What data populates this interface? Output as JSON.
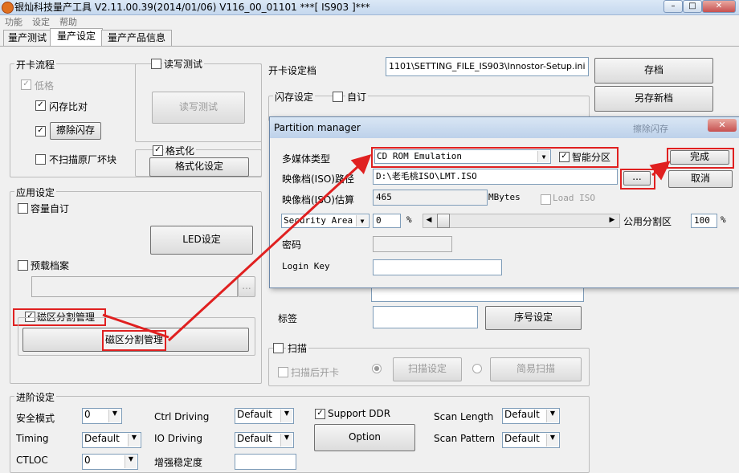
{
  "window": {
    "title": "银灿科技量产工具 V2.11.00.39(2014/01/06)    V116_00_01101                    ***[ IS903 ]***"
  },
  "menu": [
    "功能",
    "设定",
    "帮助"
  ],
  "tabs": [
    "量产测试",
    "量产设定",
    "量产产品信息"
  ],
  "card_flow": {
    "label": "开卡流程",
    "low_format": "低格",
    "flash_compare": "闪存比对",
    "erase_flash": "擦除闪存",
    "no_scan_factory_bad": "不扫描原厂坏块"
  },
  "rw_test": {
    "label": "读写测试",
    "button": "读写测试"
  },
  "format": {
    "label": "格式化",
    "button": "格式化设定"
  },
  "app_settings": {
    "label": "应用设定",
    "capacity_custom": "容量自订",
    "led_button": "LED设定",
    "preload": "预载档案",
    "preload_browse": "...",
    "partition_mgmt": "磁区分割管理",
    "partition_button": "磁区分割管理"
  },
  "open_card_file": {
    "label": "开卡设定档",
    "value": "1101\\SETTING_FILE_IS903\\Innostor-Setup.ini"
  },
  "buttons": {
    "save": "存档",
    "save_as": "另存新档",
    "serial": "序号设定"
  },
  "flash_settings": {
    "label": "闪存设定",
    "custom": "自订"
  },
  "tag": {
    "label": "标签"
  },
  "scan": {
    "label": "扫描",
    "open_after_scan": "扫描后开卡",
    "scan_settings": "扫描设定",
    "simple_scan": "简易扫描"
  },
  "advanced": {
    "label": "进阶设定",
    "safe_mode": {
      "label": "安全模式",
      "value": "0"
    },
    "timing": {
      "label": "Timing",
      "value": "Default"
    },
    "ctloc": {
      "label": "CTLOC",
      "value": "0"
    },
    "ctrl_driving": {
      "label": "Ctrl Driving",
      "value": "Default"
    },
    "io_driving": {
      "label": "IO Driving",
      "value": "Default"
    },
    "stability": {
      "label": "增强稳定度"
    },
    "support_ddr": "Support DDR",
    "option_button": "Option",
    "scan_length": {
      "label": "Scan Length",
      "value": "Default"
    },
    "scan_pattern": {
      "label": "Scan Pattern",
      "value": "Default"
    }
  },
  "partition_manager": {
    "title": "Partition manager",
    "bg_button": "擦除闪存",
    "media_type_label": "多媒体类型",
    "media_type_value": "CD ROM Emulation",
    "smart_partition": "智能分区",
    "done_button": "完成",
    "cancel_button": "取消",
    "iso_path_label": "映像档(ISO)路径",
    "iso_path_value": "D:\\老毛桃ISO\\LMT.ISO",
    "browse_button": "...",
    "iso_size_label": "映像档(ISO)估算",
    "iso_size_value": "465",
    "iso_size_unit": "MBytes",
    "load_iso": "Load ISO",
    "area_select": "Security Area",
    "area_value": "0",
    "percent": "%",
    "public_partition_label": "公用分割区",
    "public_partition_value": "100",
    "password_label": "密码",
    "login_key_label": "Login Key"
  },
  "colors": {
    "highlight": "#e02020",
    "titlebar": "#c5d8ee",
    "close": "#c75050"
  }
}
